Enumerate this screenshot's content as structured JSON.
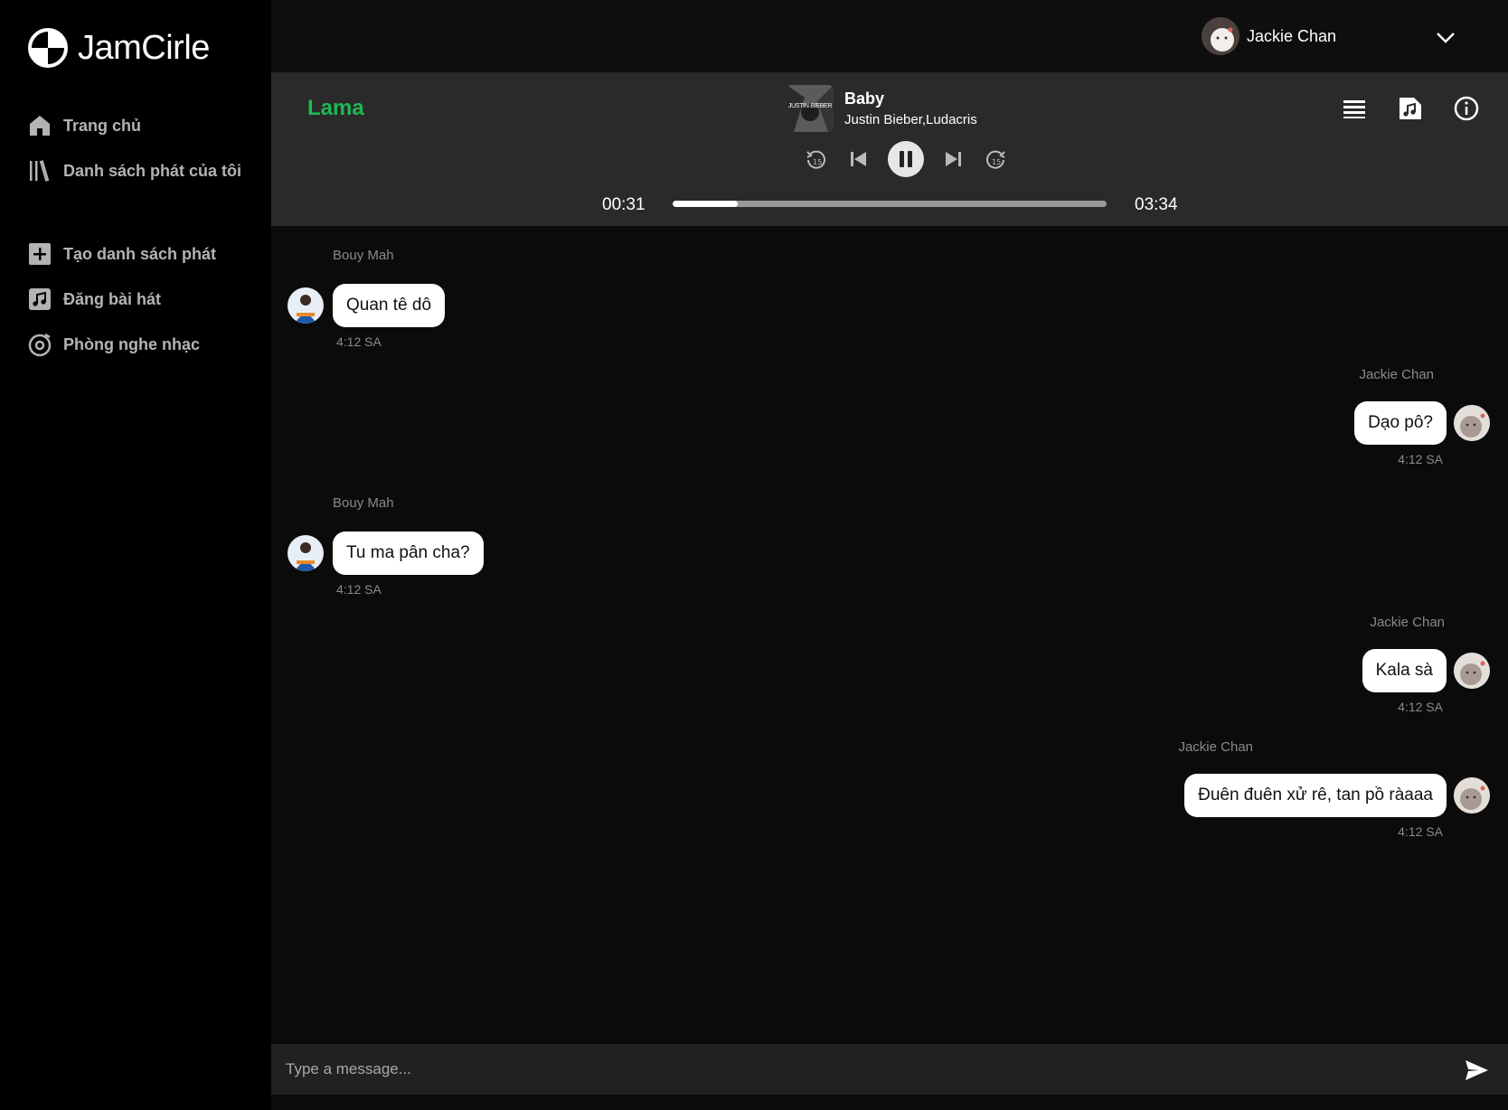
{
  "app": {
    "name": "JamCirle"
  },
  "nav": {
    "main": [
      {
        "label": "Trang chủ",
        "icon": "home-icon"
      },
      {
        "label": "Danh sách phát của tôi",
        "icon": "library-icon"
      }
    ],
    "actions": [
      {
        "label": "Tạo danh sách phát",
        "icon": "plus-square-icon"
      },
      {
        "label": "Đăng bài hát",
        "icon": "music-note-icon"
      },
      {
        "label": "Phòng nghe nhạc",
        "icon": "disc-icon"
      }
    ]
  },
  "user": {
    "name": "Jackie Chan"
  },
  "player": {
    "room": "Lama",
    "cover_label": "JUSTIN BIEBER",
    "song_title": "Baby",
    "song_artist": "Justin Bieber,Ludacris",
    "current_time": "00:31",
    "total_time": "03:34",
    "progress_fraction": 0.15
  },
  "messages": [
    {
      "sender": "Bouy Mah",
      "text": "Quan tê dô",
      "time": "4:12 SA",
      "side": "left"
    },
    {
      "sender": "Jackie Chan",
      "text": "Dạo pô?",
      "time": "4:12 SA",
      "side": "right"
    },
    {
      "sender": "Bouy Mah",
      "text": "Tu ma pân cha?",
      "time": "4:12 SA",
      "side": "left"
    },
    {
      "sender": "Jackie Chan",
      "text": "Kala sà",
      "time": "4:12 SA",
      "side": "right"
    },
    {
      "sender": "Jackie Chan",
      "text": "Đuên đuên xử rê, tan pồ ràaaa",
      "time": "4:12 SA",
      "side": "right"
    }
  ],
  "composer": {
    "placeholder": "Type a message..."
  },
  "colors": {
    "accent": "#1db954",
    "sidebar": "#000000",
    "player": "#2a2a2b",
    "bubble": "#ffffff"
  }
}
